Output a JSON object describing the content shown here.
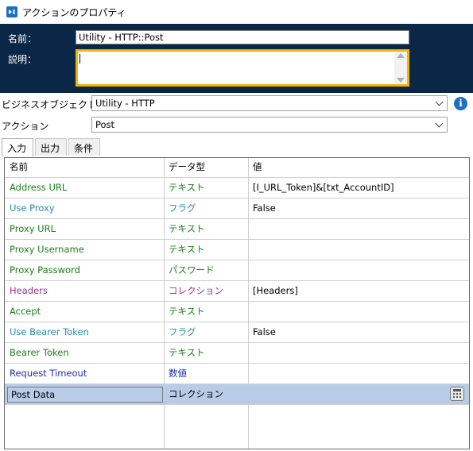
{
  "window": {
    "title": "アクションのプロパティ",
    "icon": "blue-prism-action-icon"
  },
  "form": {
    "name_label": "名前：",
    "name_value": "Utility - HTTP::Post",
    "desc_label": "説明：",
    "desc_value": "",
    "business_object_label": "ビジネスオブジェクト",
    "business_object_value": "Utility - HTTP",
    "action_label": "アクション",
    "action_value": "Post"
  },
  "tabs": [
    "入力",
    "出力",
    "条件"
  ],
  "grid": {
    "headers": [
      "名前",
      "データ型",
      "値"
    ],
    "rows": [
      {
        "name": "Address URL",
        "type": "テキスト",
        "value": "[I_URL_Token]&[txt_AccountID]",
        "color": "#1a7f1a"
      },
      {
        "name": "Use Proxy",
        "type": "フラグ",
        "value": "False",
        "color": "#2a8aa8"
      },
      {
        "name": "Proxy URL",
        "type": "テキスト",
        "value": "",
        "color": "#1a7f1a"
      },
      {
        "name": "Proxy Username",
        "type": "テキスト",
        "value": "",
        "color": "#1a7f1a"
      },
      {
        "name": "Proxy Password",
        "type": "パスワード",
        "value": "",
        "color": "#1a7f1a"
      },
      {
        "name": "Headers",
        "type": "コレクション",
        "value": "[Headers]",
        "color": "#a0309a"
      },
      {
        "name": "Accept",
        "type": "テキスト",
        "value": "",
        "color": "#1a7f1a"
      },
      {
        "name": "Use Bearer Token",
        "type": "フラグ",
        "value": "False",
        "color": "#2a8aa8"
      },
      {
        "name": "Bearer Token",
        "type": "テキスト",
        "value": "",
        "color": "#1a7f1a"
      },
      {
        "name": "Request Timeout",
        "type": "数値",
        "value": "",
        "color": "#1a2fb0"
      },
      {
        "name": "Post Data",
        "type": "コレクション",
        "value": "",
        "color": "#000000",
        "selected": true
      }
    ]
  },
  "icons": {
    "info": "info-icon",
    "expression_editor": "calculator-icon"
  }
}
